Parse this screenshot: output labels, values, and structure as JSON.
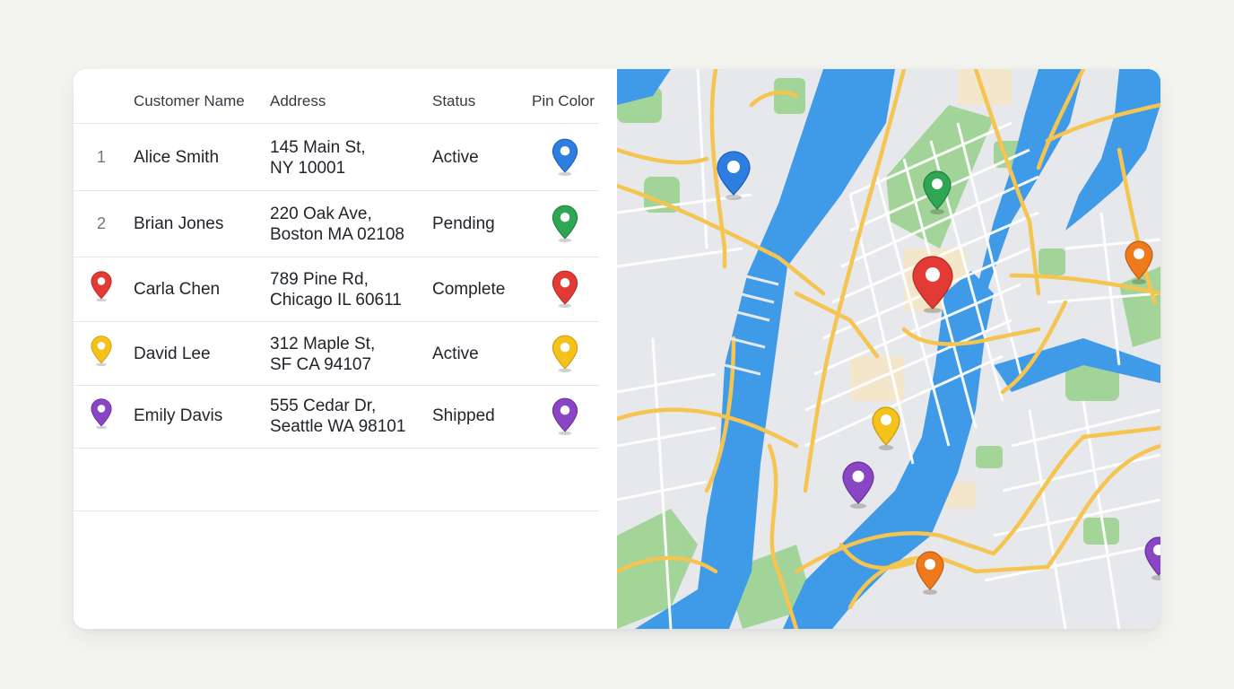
{
  "colors": {
    "blue": "#2e7de0",
    "green": "#2ea653",
    "red": "#e23b35",
    "yellow": "#f4c21a",
    "purple": "#8a45c4",
    "orange": "#ee7a1c",
    "water": "#3f9be8",
    "road": "#f5c451",
    "park": "#9bd18f"
  },
  "table": {
    "columns": [
      "",
      "Customer Name",
      "Address",
      "Status",
      "Pin Color"
    ],
    "rows": [
      {
        "index": "1",
        "name": "Alice Smith",
        "address_line1": "145 Main St,",
        "address_line2": "NY 10001",
        "status": "Active",
        "pin": "blue-pin-icon"
      },
      {
        "index": "2",
        "name": "Brian Jones",
        "address_line1": "220 Oak Ave,",
        "address_line2": "Boston MA 02108",
        "status": "Pending",
        "pin": "green-pin-icon"
      },
      {
        "index": "",
        "name": "Carla Chen",
        "address_line1": "789 Pine Rd,",
        "address_line2": "Chicago IL 60611",
        "status": "Complete",
        "pin": "red-pin-icon"
      },
      {
        "index": "",
        "name": "David Lee",
        "address_line1": "312 Maple St,",
        "address_line2": "SF CA 94107",
        "status": "Active",
        "pin": "yellow-pin-icon"
      },
      {
        "index": "",
        "name": "Emily Davis",
        "address_line1": "555 Cedar Dr,",
        "address_line2": "Seattle WA 98101",
        "status": "Shipped",
        "pin": "purple-pin-icon"
      }
    ]
  },
  "map": {
    "markers": [
      "blue-pin-icon",
      "green-pin-icon",
      "red-pin-icon",
      "orange-pin-icon",
      "yellow-pin-icon",
      "purple-pin-icon",
      "orange-pin-icon",
      "purple-pin-icon"
    ]
  }
}
